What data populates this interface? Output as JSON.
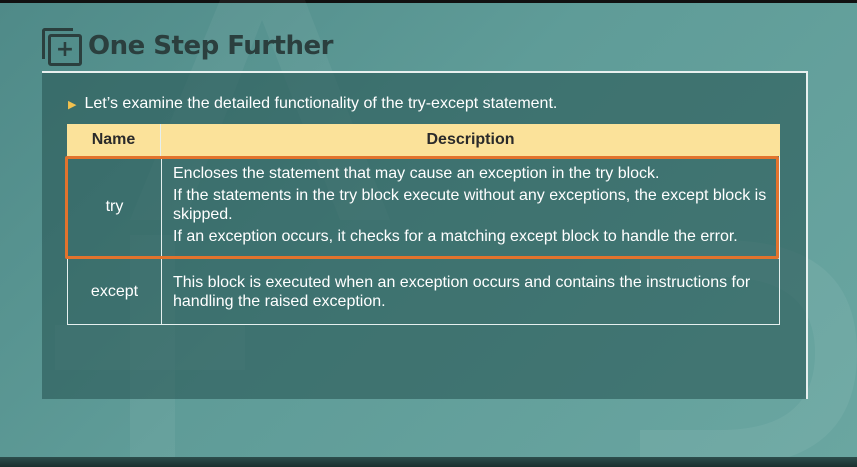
{
  "header": {
    "title": "One Step Further"
  },
  "intro": {
    "text": "Let’s examine the detailed functionality of the try-except statement."
  },
  "table": {
    "columns": [
      "Name",
      "Description"
    ],
    "rows": [
      {
        "name": "try",
        "description": [
          "Encloses the statement that may cause an exception in the try block.",
          "If the statements in the try block execute without any exceptions, the except block is skipped.",
          "If an exception occurs, it checks for a matching except block to handle the error."
        ]
      },
      {
        "name": "except",
        "description": [
          "This block is executed when an exception occurs and contains the instructions for handling the raised exception."
        ]
      }
    ]
  },
  "colors": {
    "header_bg": "#fbe29a",
    "highlight": "#e2732d",
    "bullet": "#f2c14e",
    "title": "#2b3f3e"
  },
  "icons": {
    "header": "plus-square-icon",
    "bullet": "triangle-right-icon"
  }
}
